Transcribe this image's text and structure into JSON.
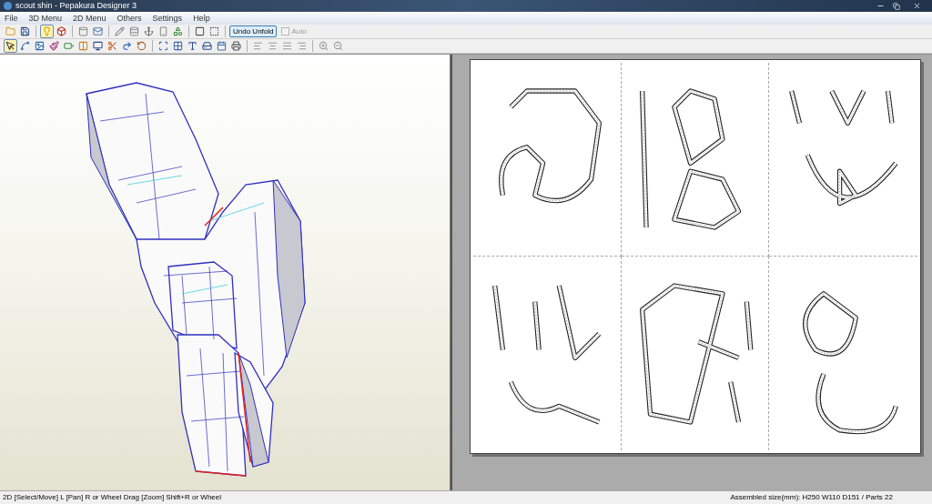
{
  "window": {
    "title": "scout shin - Pepakura Designer 3"
  },
  "menu": [
    "File",
    "3D Menu",
    "2D Menu",
    "Others",
    "Settings",
    "Help"
  ],
  "toolbar_1": [
    [
      {
        "selected": false
      },
      {
        "selected": false
      }
    ],
    [
      {
        "selected": true
      },
      {
        "selected": false
      }
    ],
    [
      {
        "selected": false
      },
      {
        "selected": false
      }
    ],
    [
      {
        "selected": false
      },
      {
        "selected": false
      },
      {
        "selected": false
      },
      {
        "selected": false
      },
      {
        "selected": false
      }
    ],
    [
      {
        "selected": false
      },
      {
        "selected": false
      }
    ]
  ],
  "undo_unfold": {
    "label": "Undo Unfold"
  },
  "auto": {
    "label": "Auto",
    "checked": false,
    "disabled": true
  },
  "toolbar_2": [
    [
      {
        "selected": true
      },
      {
        "selected": false
      },
      {
        "selected": false
      },
      {
        "selected": false
      },
      {
        "selected": false
      },
      {
        "selected": false
      },
      {
        "selected": false
      },
      {
        "selected": false
      },
      {
        "selected": false
      },
      {
        "selected": false
      }
    ],
    [
      {
        "selected": false
      },
      {
        "selected": false
      },
      {
        "selected": false
      },
      {
        "selected": false
      },
      {
        "selected": false
      },
      {
        "selected": false
      }
    ],
    [
      {
        "selected": false
      },
      {
        "selected": false
      },
      {
        "selected": false
      },
      {
        "selected": false
      }
    ],
    [
      {
        "selected": false
      },
      {
        "selected": false
      }
    ]
  ],
  "status_bar": {
    "left": "2D [Select/Move] L [Pan] R or Wheel Drag [Zoom] Shift+R or Wheel",
    "right": "Assembled size(mm): H250 W110 D151 / Parts 22"
  }
}
